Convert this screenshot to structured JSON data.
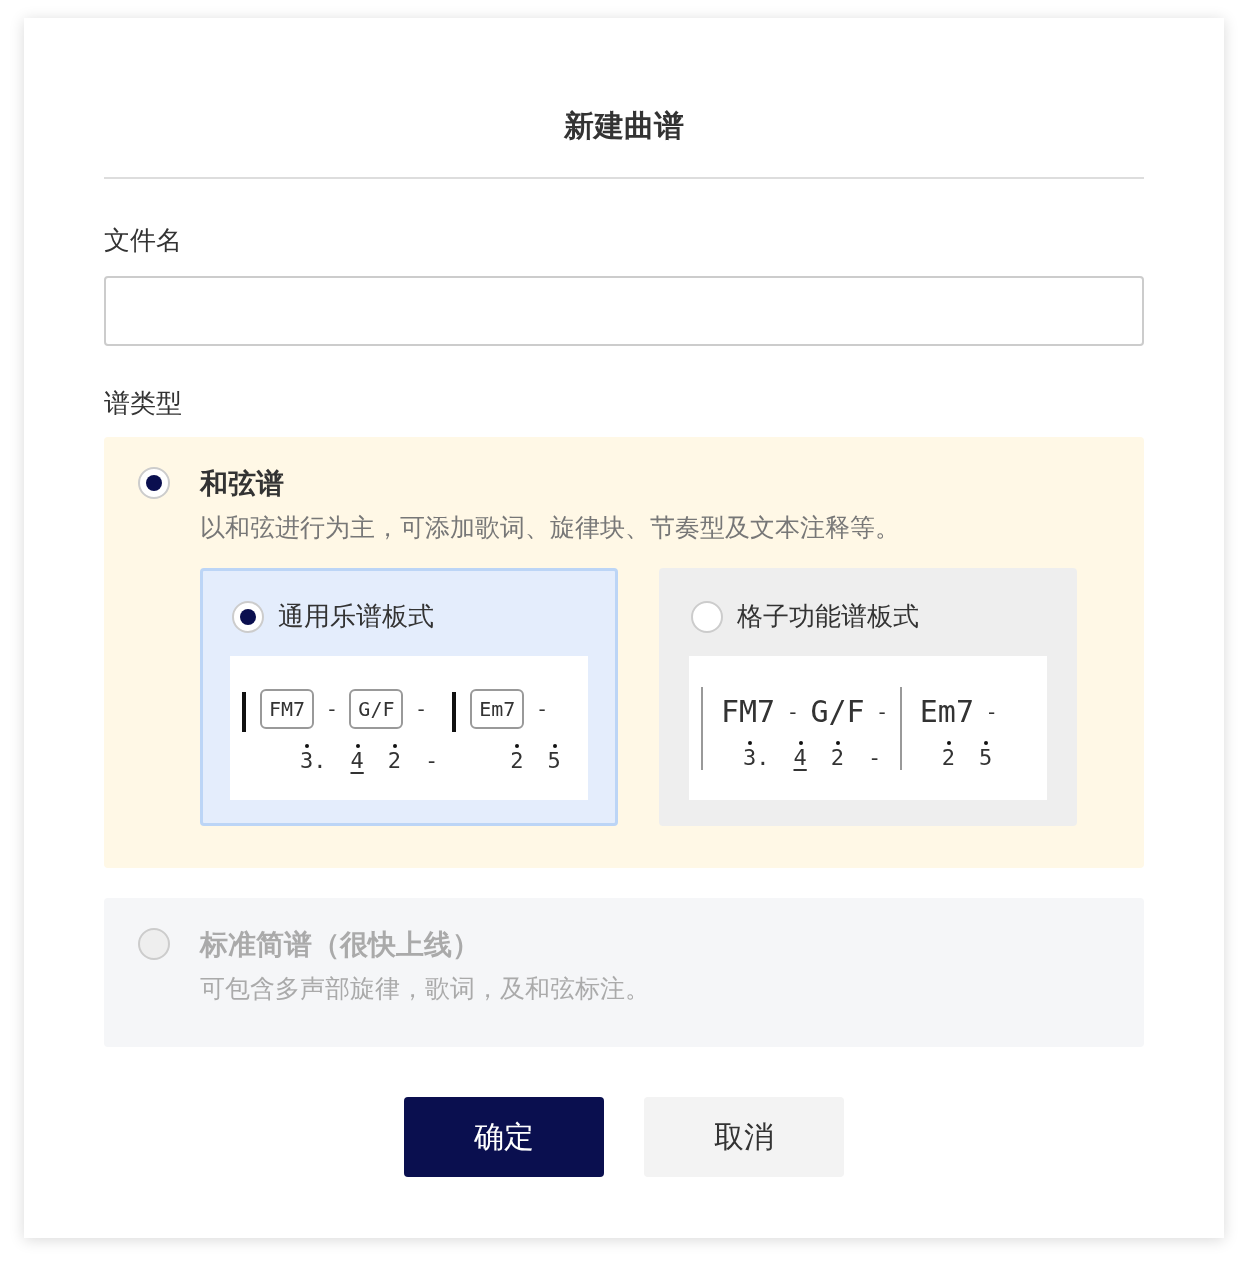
{
  "dialog": {
    "title": "新建曲谱"
  },
  "file_name": {
    "label": "文件名"
  },
  "score_type": {
    "label": "谱类型",
    "options": [
      {
        "title": "和弦谱",
        "description": "以和弦进行为主，可添加歌词、旋律块、节奏型及文本注释等。",
        "selected": true,
        "disabled": false,
        "layouts": [
          {
            "label": "通用乐谱板式",
            "selected": true,
            "kind": "boxed",
            "measures": [
              {
                "chords": [
                  {
                    "text": "FM7",
                    "kind": "chord"
                  },
                  {
                    "text": "-",
                    "kind": "dash"
                  },
                  {
                    "text": "G/F",
                    "kind": "chord"
                  },
                  {
                    "text": "-",
                    "kind": "dash"
                  }
                ],
                "notes": [
                  {
                    "text": "3.",
                    "high": true,
                    "underline": false
                  },
                  {
                    "text": "4",
                    "high": true,
                    "underline": true
                  },
                  {
                    "text": "2",
                    "high": true,
                    "underline": false
                  },
                  {
                    "text": "-",
                    "high": false,
                    "underline": false
                  }
                ]
              },
              {
                "chords": [
                  {
                    "text": "Em7",
                    "kind": "chord"
                  },
                  {
                    "text": "-",
                    "kind": "dash"
                  }
                ],
                "notes": [
                  {
                    "text": "2",
                    "high": true,
                    "underline": false
                  },
                  {
                    "text": "5",
                    "high": true,
                    "underline": false
                  }
                ]
              }
            ]
          },
          {
            "label": "格子功能谱板式",
            "selected": false,
            "kind": "grid",
            "measures": [
              {
                "chords": [
                  {
                    "text": "FM7",
                    "kind": "chord"
                  },
                  {
                    "text": "-",
                    "kind": "dash"
                  },
                  {
                    "text": "G/F",
                    "kind": "chord"
                  },
                  {
                    "text": "-",
                    "kind": "dash"
                  }
                ],
                "notes": [
                  {
                    "text": "3.",
                    "high": true,
                    "underline": false
                  },
                  {
                    "text": "4",
                    "high": true,
                    "underline": true
                  },
                  {
                    "text": "2",
                    "high": true,
                    "underline": false
                  },
                  {
                    "text": "-",
                    "high": false,
                    "underline": false
                  }
                ]
              },
              {
                "chords": [
                  {
                    "text": "Em7",
                    "kind": "chord"
                  },
                  {
                    "text": "-",
                    "kind": "dash"
                  }
                ],
                "notes": [
                  {
                    "text": "2",
                    "high": true,
                    "underline": false
                  },
                  {
                    "text": "5",
                    "high": true,
                    "underline": false
                  }
                ]
              }
            ]
          }
        ]
      },
      {
        "title": "标准简谱（很快上线）",
        "description": "可包含多声部旋律，歌词，及和弦标注。",
        "selected": false,
        "disabled": true
      }
    ]
  },
  "buttons": [
    {
      "label": "确定",
      "kind": "primary"
    },
    {
      "label": "取消",
      "kind": "secondary"
    }
  ]
}
